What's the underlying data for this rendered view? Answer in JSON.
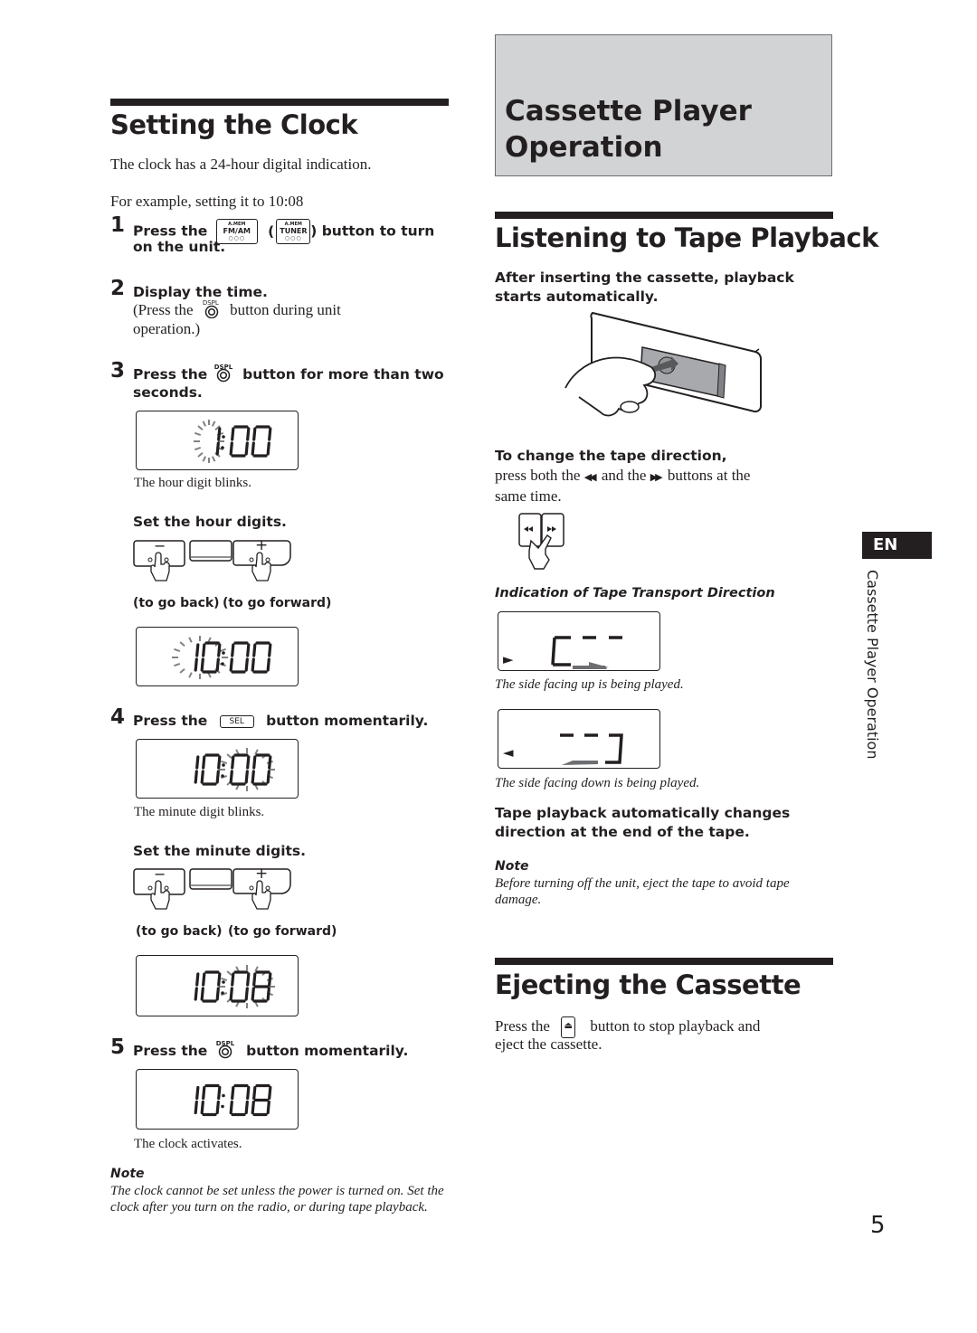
{
  "left": {
    "section_title": "Setting the Clock",
    "intro": "The clock has a 24-hour digital indication.",
    "example": "For example, setting it to 10:08",
    "steps": [
      {
        "num": "1",
        "pre": "Press the",
        "mid": "(",
        "post": ") button to turn",
        "line2": "on the unit.",
        "button1": {
          "top": "A.MEM",
          "label": "FM/AM"
        },
        "button2": {
          "top": "A.MEM",
          "label": "TUNER"
        }
      },
      {
        "num": "2",
        "title": "Display the time.",
        "sub_pre": "(Press the",
        "sub_post": "button during  unit",
        "sub_line2": "operation.)",
        "button_label": "DSPL"
      },
      {
        "num": "3",
        "pre": "Press the",
        "post": "button for more than two",
        "line2": "seconds.",
        "button_label": "DSPL"
      },
      {
        "num": "4",
        "pre": "Press the",
        "post": "button momentarily.",
        "button_label": "SEL"
      },
      {
        "num": "5",
        "pre": "Press the",
        "post": "button momentarily.",
        "button_label": "DSPL"
      }
    ],
    "displays": {
      "d1": {
        "value": "1:00",
        "blinking": "hour",
        "caption": "The hour digit blinks."
      },
      "d2": {
        "value": "10:00",
        "blinking": "hour"
      },
      "d3": {
        "value": "10:00",
        "blinking": "minute",
        "caption": "The minute digit blinks."
      },
      "d4": {
        "value": "10:08",
        "blinking": "minute"
      },
      "d5": {
        "value": "10:08",
        "blinking": "none",
        "caption": "The clock activates."
      }
    },
    "set_hour": "Set the hour digits.",
    "set_minute": "Set the minute digits.",
    "go_back": "(to go back)",
    "go_forward": "(to go forward)",
    "minus": "−",
    "plus": "+",
    "note_title": "Note",
    "note_text": "The clock cannot be set unless the power is turned on. Set the clock after you turn on the radio, or during tape playback."
  },
  "right": {
    "chapter_title_line1": "Cassette Player",
    "chapter_title_line2": "Operation",
    "section1_title": "Listening to Tape Playback",
    "section1_lead_line1": "After inserting the cassette, playback",
    "section1_lead_line2": "starts automatically.",
    "change_dir_title": "To change the tape direction,",
    "change_dir_pre": "press both the",
    "change_dir_mid": "and the",
    "change_dir_post": "buttons at the",
    "change_dir_line2": "same time.",
    "rew_glyph": "◀◀",
    "ff_glyph": "▶▶",
    "indication_title": "Indication of Tape Transport Direction",
    "forward_caption": "The side facing up is being played.",
    "reverse_caption": "The side facing down is being played.",
    "forward_arrow": "►",
    "reverse_arrow": "◄",
    "auto_change_line1": "Tape playback automatically changes",
    "auto_change_line2": "direction at the end of the tape.",
    "note_title": "Note",
    "note_line1": "Before turning off the unit, eject the tape to avoid tape",
    "note_line2": "damage.",
    "section2_title": "Ejecting the Cassette",
    "eject_pre": "Press the",
    "eject_post": "button to stop playback and",
    "eject_line2": "eject the cassette.",
    "eject_glyph": "⏏"
  },
  "sidebar": {
    "lang_tab": "EN",
    "vertical_label": "Cassette Player Operation"
  },
  "page_number": "5"
}
